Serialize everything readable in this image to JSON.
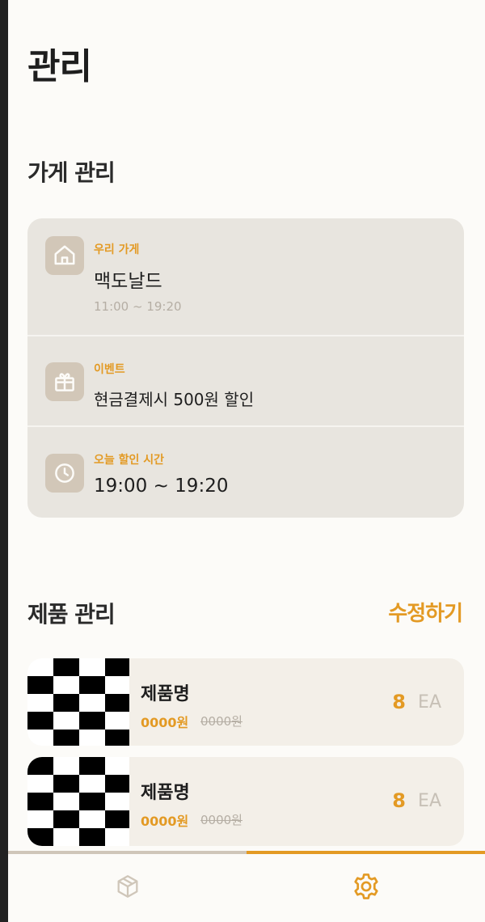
{
  "page": {
    "title": "관리"
  },
  "store_section": {
    "title": "가게 관리",
    "rows": [
      {
        "icon": "house-icon",
        "label": "우리 가게",
        "value": "맥도날드",
        "sub": "11:00 ~ 19:20"
      },
      {
        "icon": "gift-icon",
        "label": "이벤트",
        "value": "현금결제시 500원 할인"
      },
      {
        "icon": "clock-icon",
        "label": "오늘 할인 시간",
        "value": "19:00 ~ 19:20"
      }
    ]
  },
  "product_section": {
    "title": "제품 관리",
    "edit_label": "수정하기",
    "items": [
      {
        "name": "제품명",
        "price": "0000원",
        "original_price": "0000원",
        "quantity": "8",
        "unit": "EA"
      },
      {
        "name": "제품명",
        "price": "0000원",
        "original_price": "0000원",
        "quantity": "8",
        "unit": "EA"
      }
    ]
  },
  "tabbar": {
    "tabs": [
      {
        "icon": "box-icon",
        "active": false
      },
      {
        "icon": "gear-icon",
        "active": true
      }
    ]
  },
  "colors": {
    "accent": "#e39a24",
    "background": "#fcfbf8",
    "card": "#e8e5df",
    "product_card": "#f3efe8",
    "icon_bg": "#d2c7b8",
    "muted_text": "#b5aea4"
  }
}
